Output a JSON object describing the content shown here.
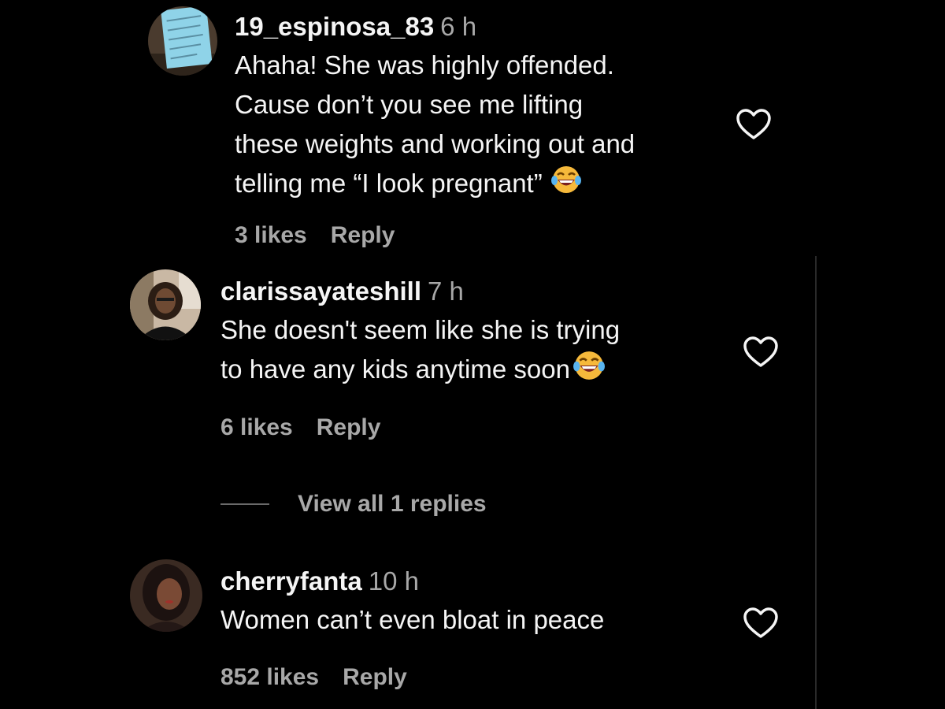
{
  "comments": [
    {
      "username": "19_espinosa_83",
      "time": "6 h",
      "text_lines": [
        "Ahaha! She was highly offended.",
        "Cause don’t you see me lifting",
        "these weights and working out and",
        "telling me “I look pregnant”"
      ],
      "emoji": "laughing-tears-emoji",
      "likes": "3 likes",
      "reply_label": "Reply"
    },
    {
      "username": "clarissayateshill",
      "time": "7 h",
      "text_lines": [
        "She doesn't seem like she is trying",
        "to have any kids anytime soon"
      ],
      "emoji": "laughing-tears-emoji",
      "likes": "6 likes",
      "reply_label": "Reply"
    },
    {
      "username": "cherryfanta",
      "time": "10 h",
      "text_lines": [
        "Women can’t even bloat in peace"
      ],
      "likes": "852 likes",
      "reply_label": "Reply"
    }
  ],
  "view_replies": "View all 1 replies",
  "icons": {
    "like": "heart-outline-icon"
  },
  "colors": {
    "background": "#000000",
    "primary_text": "#f5f5f5",
    "secondary_text": "#a8a8a8"
  }
}
